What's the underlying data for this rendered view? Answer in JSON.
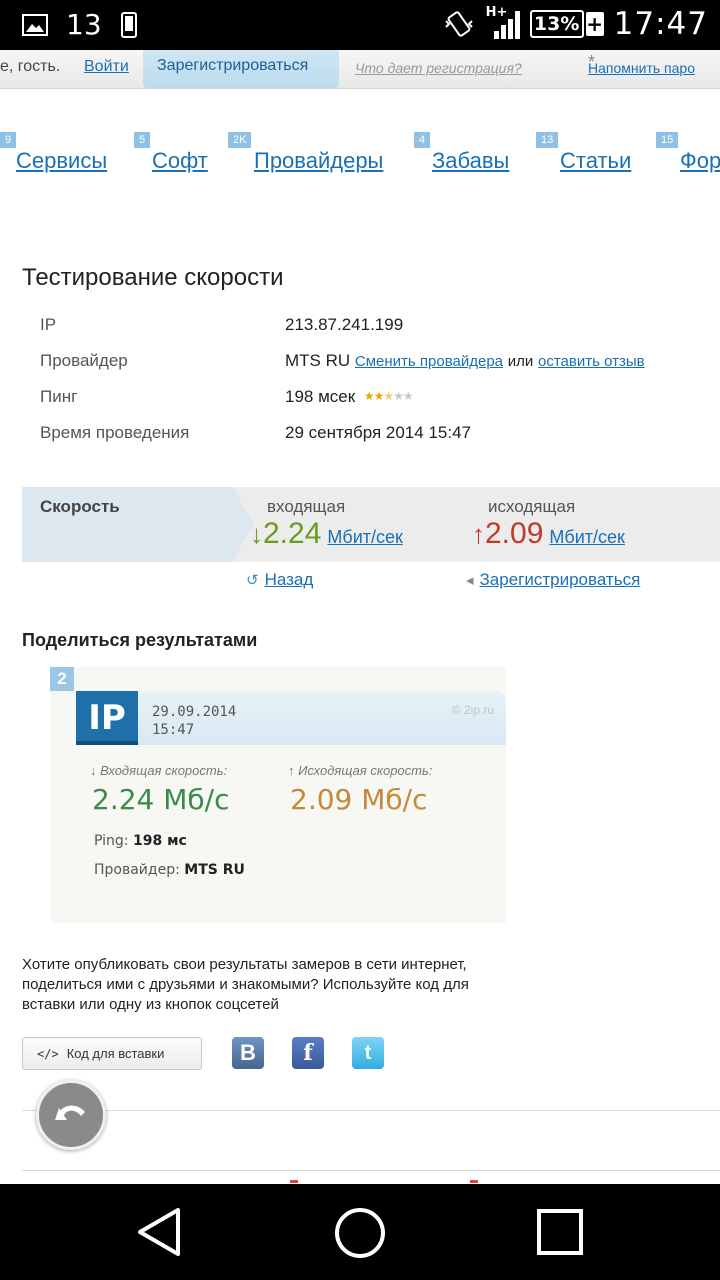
{
  "status_bar": {
    "notification_count": "13",
    "network": "H+",
    "battery": "13%",
    "battery_plus": "+",
    "time": "17:47"
  },
  "top_bar": {
    "greeting": "е, гость.",
    "login": "Войти",
    "register": "Зарегистрироваться",
    "what_register": "Что дает регистрация?",
    "remind_star": "*",
    "remind_password": "Напомнить паро"
  },
  "nav": [
    {
      "badge": "9",
      "label": "Сервисы"
    },
    {
      "badge": "5",
      "label": "Софт"
    },
    {
      "badge": "2K",
      "label": "Провайдеры"
    },
    {
      "badge": "4",
      "label": "Забавы"
    },
    {
      "badge": "13",
      "label": "Статьи"
    },
    {
      "badge": "15",
      "label": "Фор"
    }
  ],
  "speed_test": {
    "title": "Тестирование скорости",
    "rows": [
      {
        "label": "IP",
        "value": "213.87.241.199"
      },
      {
        "label": "Провайдер",
        "value": "MTS RU",
        "link1": "Сменить провайдера",
        "sep": "или",
        "link2": "оставить отзыв"
      },
      {
        "label": "Пинг",
        "value": "198 мсек",
        "rating": 2.5,
        "rating_max": 5
      },
      {
        "label": "Время проведения",
        "value": "29 сентября 2014 15:47"
      }
    ],
    "speed_label": "Скорость",
    "incoming_label": "входящая",
    "incoming_arrow": "↓",
    "incoming_value": "2.24",
    "outgoing_label": "исходящая",
    "outgoing_arrow": "↑",
    "outgoing_value": "2.09",
    "unit": "Мбит/сек",
    "back": "Назад",
    "register": "Зарегистрироваться",
    "colors": {
      "incoming": "#6a9a1f",
      "outgoing": "#c0392b",
      "link": "#1a6fb5"
    }
  },
  "share": {
    "title": "Поделиться результатами",
    "card": {
      "badge": "2",
      "logo": "IP",
      "date": "29.09.2014",
      "time": "15:47",
      "copyright": "© 2ip.ru",
      "in_label": "↓ Входящая скорость:",
      "in_value": "2.24 Мб/с",
      "out_label": "↑ Исходящая скорость:",
      "out_value": "2.09 Мб/с",
      "ping_label": "Ping:",
      "ping_value": "198 мс",
      "provider_label": "Провайдер:",
      "provider_value": "MTS RU"
    },
    "description": "Хотите опубликовать свои результаты замеров в сети интернет, поделиться ими с друзьями и знакомыми? Используйте код для вставки или одну из кнопок соцсетей",
    "embed_icon": "</>",
    "embed_button": "Код для вставки",
    "social": [
      {
        "name": "vk-icon",
        "glyph": "B"
      },
      {
        "name": "facebook-icon",
        "glyph": "f"
      },
      {
        "name": "twitter-icon",
        "glyph": "t"
      }
    ]
  }
}
